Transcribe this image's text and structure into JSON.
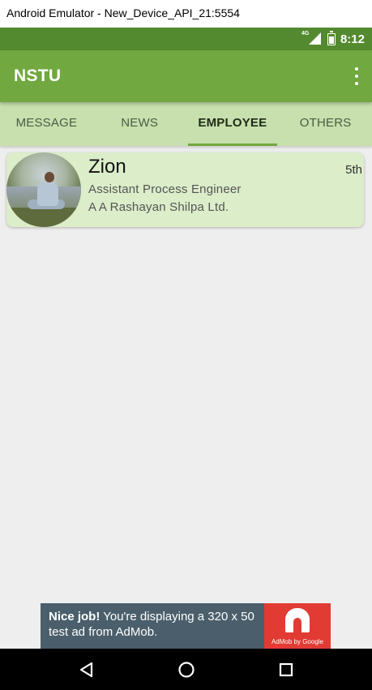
{
  "window": {
    "title": "Android Emulator - New_Device_API_21:5554"
  },
  "status_bar": {
    "network": "4G",
    "time": "8:12",
    "signal_icon": "cell-signal-icon",
    "battery_icon": "battery-charging-icon"
  },
  "app_bar": {
    "title": "NSTU",
    "menu_icon": "more-vert-icon"
  },
  "tabs": [
    {
      "label": "MESSAGE",
      "active": false
    },
    {
      "label": "NEWS",
      "active": false
    },
    {
      "label": "EMPLOYEE",
      "active": true
    },
    {
      "label": "OTHERS",
      "active": false
    }
  ],
  "employees": [
    {
      "name": "Zion",
      "badge": "5th",
      "designation": "Assistant Process Engineer",
      "company": "A A Rashayan Shilpa Ltd."
    }
  ],
  "ad": {
    "headline": "Nice job!",
    "body": " You're displaying a 320 x 50 test ad from AdMob.",
    "brand": "AdMob by Google"
  },
  "nav_bar": {
    "back_icon": "back-triangle-icon",
    "home_icon": "home-circle-icon",
    "recents_icon": "recents-square-icon"
  },
  "colors": {
    "status_bar": "#548a2f",
    "app_bar": "#71a83f",
    "tab_bar": "#c7e0ad",
    "card": "#dbedc9",
    "background": "#eeeeee",
    "ad_bg": "#4a5f6b",
    "ad_logo": "#e13b34"
  }
}
